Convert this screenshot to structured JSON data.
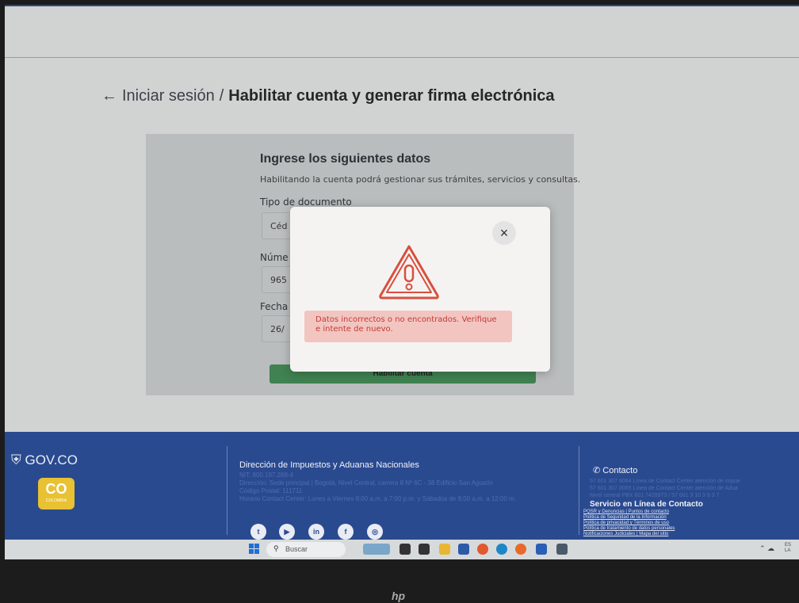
{
  "breadcrumb": {
    "back_arrow": "←",
    "parent": "Iniciar sesión",
    "separator": "/",
    "current": "Habilitar cuenta y generar firma electrónica"
  },
  "form": {
    "title": "Ingrese los siguientes datos",
    "subtitle": "Habilitando la cuenta podrá gestionar sus trámites, servicios y consultas.",
    "doc_type_label": "Tipo de documento",
    "doc_type_value": "Céd",
    "number_label": "Núme",
    "number_value": "965",
    "date_label": "Fecha",
    "date_value": "26/",
    "submit_label": "Habilitar cuenta"
  },
  "modal": {
    "close_glyph": "×",
    "icon": "warning-triangle-icon",
    "error_message": "Datos incorrectos o no encontrados. Verifique e intente de nuevo."
  },
  "footer": {
    "gov_logo": "GOV.CO",
    "co_badge": "CO",
    "co_badge_sub": "COLOMBIA",
    "entity_title": "Dirección de Impuestos y Aduanas Nacionales",
    "entity_lines": [
      "NIT: 800.197.268-4",
      "Dirección: Sede principal | Bogotá, Nivel Central, carrera 8 Nº 6C - 38 Edificio San Agustín",
      "Código Postal: 111711",
      "Horario Contact Center: Lunes a Viernes 8:00 a.m. a 7:00 p.m. y Sábados de 8:00 a.m. a 12:00 m."
    ],
    "contact_title": "Contacto",
    "contact_lines": [
      "57 601 307 8064 Línea de Contact Center atención de impue",
      "57 601 307 8065 Línea de Contact Center atención de Adua",
      "Nivel central PBX 601 7428973 / 57 601 3 10 3 9 3 7"
    ],
    "service_title": "Servicio en Línea de Contacto",
    "service_links": [
      "PQSR y Denuncias | Puntos de contacto",
      "Política de Seguridad de la Información",
      "Política de privacidad y Términos de uso",
      "Política de tratamiento de datos personales",
      "Notificaciones Judiciales | Mapa del sitio"
    ],
    "social": [
      "twitter-icon",
      "youtube-icon",
      "linkedin-icon",
      "facebook-icon",
      "instagram-icon"
    ]
  },
  "taskbar": {
    "search_placeholder": "Buscar",
    "tray_lang": "ES",
    "tray_lang2": "LA"
  },
  "bezel": {
    "brand": "hp"
  }
}
